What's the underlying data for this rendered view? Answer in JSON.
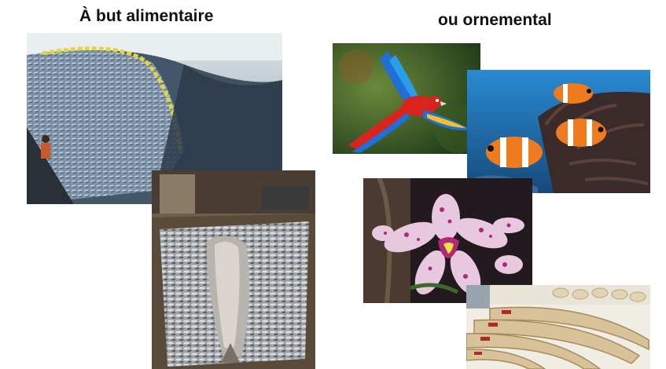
{
  "headings": {
    "food": "À but alimentaire",
    "ornamental": "ou ornemental"
  },
  "photos": {
    "fishing_net": {
      "subject": "trawl net full of fish",
      "colors": [
        "#8fa3b8",
        "#3b4a5c",
        "#e3d53a"
      ]
    },
    "ship_hold": {
      "subject": "ship hold filled with fish and a dolphin",
      "colors": [
        "#8a7a66",
        "#c9ccd1",
        "#5a4a3a"
      ]
    },
    "macaw": {
      "subject": "scarlet macaw in flight",
      "colors": [
        "#2f5a2a",
        "#1f6fd6",
        "#d8231e"
      ]
    },
    "clownfish": {
      "subject": "clownfish among sea anemone",
      "colors": [
        "#1f6db5",
        "#f07a1e",
        "#3a2a2a"
      ]
    },
    "orchid": {
      "subject": "spotted purple orchid",
      "colors": [
        "#2a1e22",
        "#e7c8df",
        "#b0287a"
      ]
    },
    "ivory": {
      "subject": "stack of elephant tusks",
      "colors": [
        "#d8c29a",
        "#b02a2a",
        "#f2ede0"
      ]
    }
  }
}
